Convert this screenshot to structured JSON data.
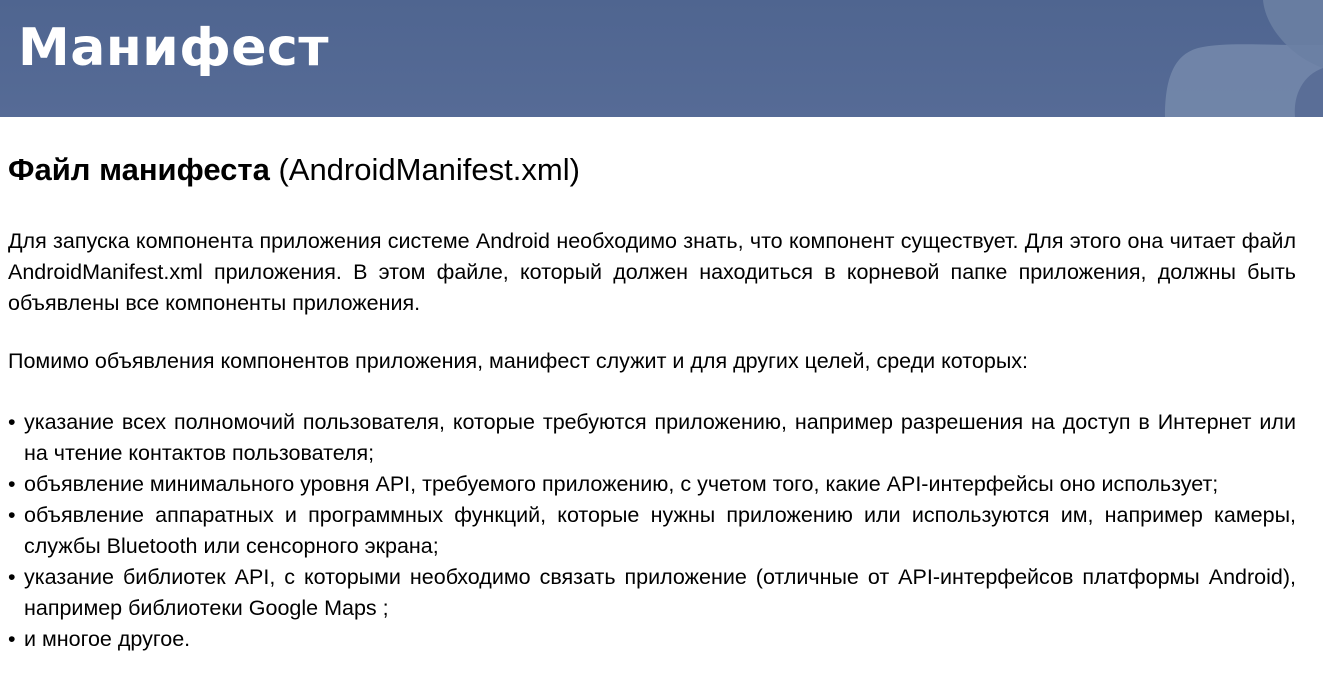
{
  "slide": {
    "title": "Манифест",
    "subtitle_bold": "Файл манифеста",
    "subtitle_rest": " (AndroidManifest.xml)"
  },
  "paragraphs": [
    "Для запуска компонента приложения системе Android необходимо знать, что компонент существует. Для этого она читает файл AndroidManifest.xml приложения. В этом файле, который должен находиться в корневой папке приложения, должны быть объявлены все компоненты приложения.",
    "Помимо объявления компонентов приложения, манифест служит и для других целей, среди которых:"
  ],
  "bullet_char": "•",
  "bullets": [
    "указание всех полномочий пользователя, которые требуются приложению, например разрешения на доступ в Интернет или на чтение контактов пользователя;",
    "объявление минимального уровня API, требуемого приложению, с учетом того, какие API-интерфейсы оно использует;",
    "объявление аппаратных и программных функций, которые нужны приложению или используются им, например камеры, службы Bluetooth или сенсорного экрана;",
    "указание библиотек API, с которыми необходимо связать приложение (отличные от API-интерфейсов платформы Android), например библиотеки Google Maps ;",
    "и многое другое."
  ],
  "colors": {
    "header_bg": "#526892",
    "header_deco": "#7d90b2",
    "title_text": "#ffffff",
    "body_text": "#000000"
  }
}
